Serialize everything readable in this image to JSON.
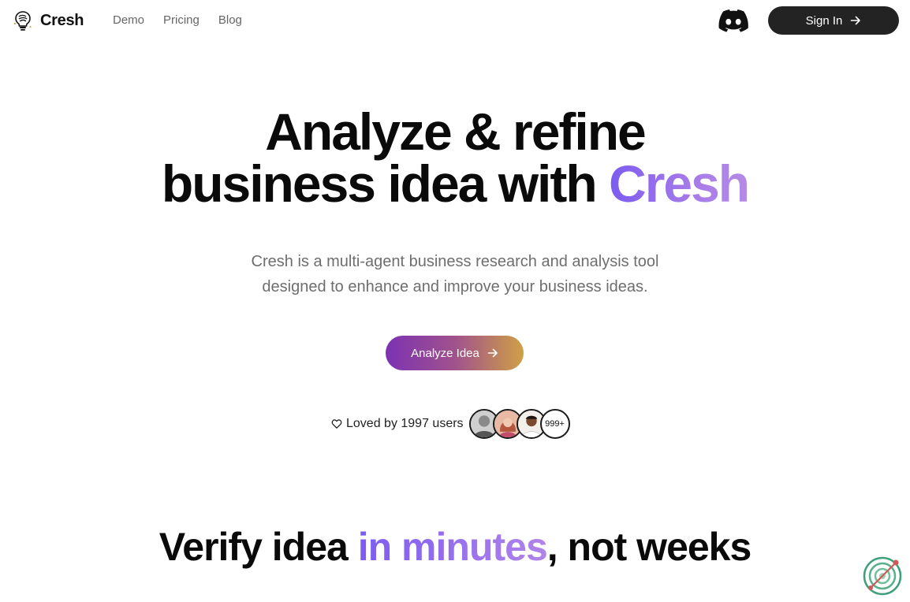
{
  "header": {
    "logo_text": "Cresh",
    "nav": [
      {
        "label": "Demo"
      },
      {
        "label": "Pricing"
      },
      {
        "label": "Blog"
      }
    ],
    "signin_label": "Sign In"
  },
  "hero": {
    "title_line1": "Analyze & refine",
    "title_line2_prefix": "business idea with ",
    "title_line2_highlight": "Cresh",
    "subtitle_line1": "Cresh is a multi-agent business research and analysis tool",
    "subtitle_line2": "designed to enhance and improve your business ideas.",
    "cta_label": "Analyze Idea",
    "loved_text": "Loved by 1997 users",
    "avatar_count": "999+"
  },
  "section": {
    "title_prefix": "Verify idea ",
    "title_highlight": "in minutes",
    "title_suffix": ", not weeks"
  },
  "colors": {
    "brand_purple": "#7b5cf0",
    "button_dark": "#232323",
    "cta_gradient_start": "#7b32b3",
    "cta_gradient_end": "#cfa045"
  },
  "icons": [
    "lightbulb-logo-icon",
    "discord-icon",
    "arrow-right-icon",
    "heart-icon",
    "chat-widget-icon"
  ]
}
